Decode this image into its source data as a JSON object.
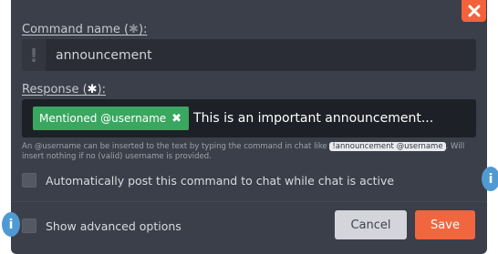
{
  "close_icon": "close-icon",
  "command_name": {
    "label": "Command name (",
    "star": "✱",
    "label_end": "):",
    "prefix_icon": "!",
    "value": "announcement"
  },
  "response": {
    "label": "Response (",
    "star": "✱",
    "label_end": "):",
    "tag_label": "Mentioned @username",
    "tag_remove": "✖",
    "text": "This is an important announcement..."
  },
  "hint": {
    "part1": "An @username can be inserted to the text by typing the command in chat like",
    "code": "!announcement @username",
    "part2": ". Will insert nothing if no (valid) username is provided."
  },
  "auto_post": {
    "label": "Automatically post this command to chat while chat is active",
    "checked": false
  },
  "advanced": {
    "label": "Show advanced options",
    "checked": false
  },
  "buttons": {
    "cancel": "Cancel",
    "save": "Save"
  },
  "info_icon_glyph": "i",
  "colors": {
    "dialog_bg": "#3b3f49",
    "accent": "#f1663f",
    "tag_green": "#3aa760",
    "info_blue": "#4f9ad2"
  }
}
